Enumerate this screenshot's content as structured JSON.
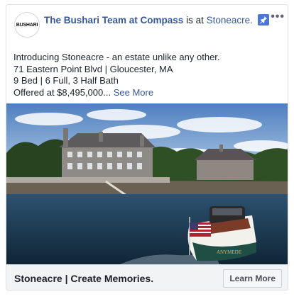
{
  "post": {
    "avatar_text": "BUSHARI",
    "page_name": "The Bushari Team at Compass",
    "connector": "is at",
    "location": "Stoneacre.",
    "more_icon": "•••",
    "body_lines": [
      "Introducing Stoneacre - an estate unlike any other.",
      "71 Eastern Point Blvd | Gloucester, MA",
      "9 Bed | 6 Full, 3 Half Bath",
      "Offered at $8,495,000..."
    ],
    "see_more": "See More"
  },
  "footer": {
    "headline": "Stoneacre | Create Memories.",
    "cta_label": "Learn More"
  },
  "boat": {
    "name_text": "ANYMEDE"
  },
  "colors": {
    "link": "#365899",
    "pin": "#4a76d8",
    "footer_bg": "#f2f3f5"
  }
}
